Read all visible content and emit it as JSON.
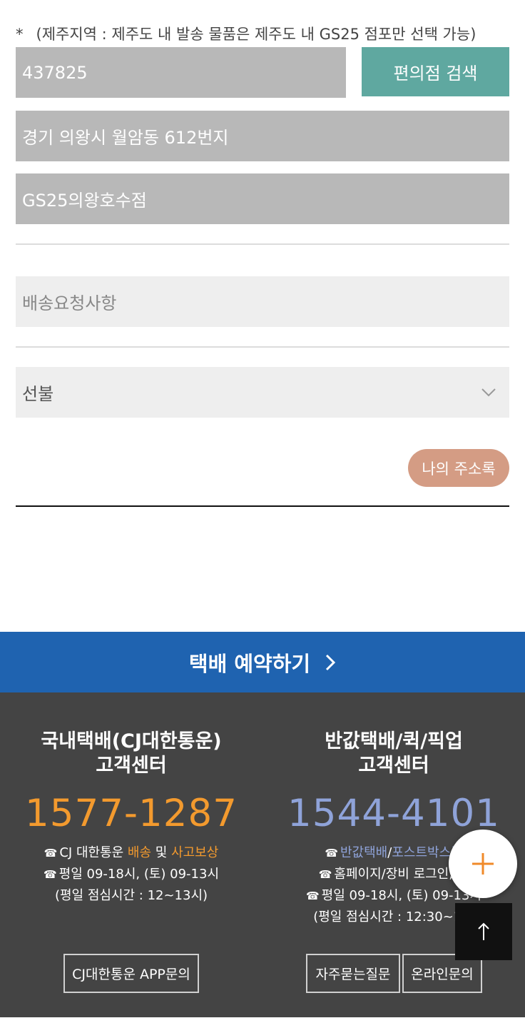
{
  "form": {
    "notice_star": "*",
    "notice": "(제주지역 : 제주도 내 발송 물품은 제주도 내 GS25 점포만 선택 가능)",
    "zipcode": "437825",
    "search_button": "편의점 검색",
    "address": "경기 의왕시 월암동 612번지",
    "store_name": "GS25의왕호수점",
    "request_placeholder": "배송요청사항",
    "payment_selected": "선불",
    "address_book_button": "나의 주소록"
  },
  "cta": {
    "label": "택배 예약하기"
  },
  "footer": {
    "left": {
      "title_line1": "국내택배(CJ대한통운)",
      "title_line2": "고객센터",
      "phone": "1577-1287",
      "info1_prefix": "CJ 대한통운 ",
      "info1_link1": "배송",
      "info1_mid": " 및 ",
      "info1_link2": "사고보상",
      "info2": "평일 09-18시, (토) 09-13시",
      "info3": "(평일 점심시간 : 12~13시)",
      "button": "CJ대한통운 APP문의"
    },
    "right": {
      "title_line1": "반값택배/퀵/픽업",
      "title_line2": "고객센터",
      "phone": "1544-4101",
      "info1_link1": "반값택배",
      "info1_sep": "/",
      "info1_link2": "포스트박스퀵",
      "info2": "홈페이지/장비 로그인, 결",
      "info3": "평일 09-18시, (토) 09-13시",
      "info4": "(평일 점심시간 : 12:30~13:",
      "button_faq": "자주묻는질문",
      "button_online": "온라인문의"
    },
    "tel_glyph": "☎"
  },
  "colors": {
    "teal": "#5fa8a0",
    "blue": "#1f63b0",
    "orange": "#f39a2e",
    "accent_blue": "#8fa3d9",
    "addr_btn": "#d49c84"
  }
}
